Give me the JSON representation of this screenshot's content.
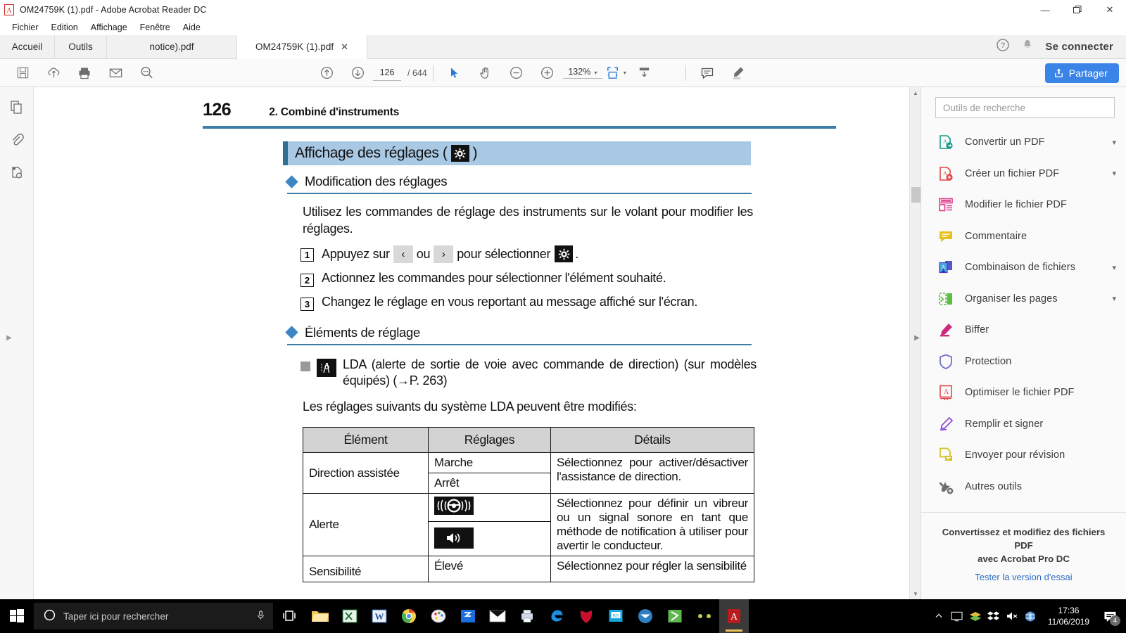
{
  "window": {
    "title": "OM24759K (1).pdf - Adobe Acrobat Reader DC",
    "minimize": "—",
    "restore": "❐",
    "close": "✕"
  },
  "menu": {
    "items": [
      "Fichier",
      "Edition",
      "Affichage",
      "Fenêtre",
      "Aide"
    ]
  },
  "tabs": {
    "home": "Accueil",
    "tools": "Outils",
    "items": [
      {
        "label": "notice).pdf",
        "active": false,
        "closable": false
      },
      {
        "label": "OM24759K (1).pdf",
        "active": true,
        "closable": true,
        "close": "✕"
      }
    ],
    "signin": "Se connecter"
  },
  "toolbar": {
    "save": "save-icon",
    "upload": "cloud-upload-icon",
    "print": "print-icon",
    "email": "email-icon",
    "find": "find-icon",
    "prev_page": "arrow-up-circle-icon",
    "next_page": "arrow-down-circle-icon",
    "page_current": "126",
    "page_separator": "/",
    "page_total": "644",
    "select_tool": "cursor-icon",
    "hand_tool": "hand-icon",
    "zoom_out": "zoom-out-icon",
    "zoom_in": "zoom-in-icon",
    "zoom_level": "132%",
    "zoom_caret": "▾",
    "fit_page": "fit-page-icon",
    "fit_caret": "▾",
    "scroll_mode": "scroll-mode-icon",
    "comment": "comment-icon",
    "highlight": "highlighter-icon",
    "share_label": "Partager"
  },
  "leftrail": {
    "thumbnails": "page-thumbnails-icon",
    "attachments": "attachments-icon",
    "docinfo": "document-info-icon",
    "expand": "▶"
  },
  "document": {
    "page_number": "126",
    "chapter": "2. Combiné d'instruments",
    "section_title_pre": "Affichage des réglages (",
    "section_title_post": ")",
    "subhead_1": "Modification des réglages",
    "intro": "Utilisez les commandes de réglage des instruments sur le volant pour modifier les réglages.",
    "steps": [
      {
        "num": "1",
        "pre": "Appuyez sur",
        "key_left": "‹",
        "mid": "ou",
        "key_right": "›",
        "post": "pour sélectionner",
        "tail": "."
      },
      {
        "num": "2",
        "text": "Actionnez les commandes pour sélectionner l'élément souhaité."
      },
      {
        "num": "3",
        "text": "Changez le réglage en vous reportant au message affiché sur l'écran."
      }
    ],
    "subhead_2": "Éléments de réglage",
    "lda_text": "LDA (alerte de sortie de voie avec commande de direction) (sur modèles équipés) (→P. 263)",
    "lda_intro": "Les réglages suivants du système LDA peuvent être modifiés:",
    "table": {
      "headers": [
        "Élément",
        "Réglages",
        "Détails"
      ],
      "rows": [
        {
          "element": "Direction assistée",
          "settings": [
            "Marche",
            "Arrêt"
          ],
          "details": "Sélectionnez pour activer/désactiver l'assistance de direction."
        },
        {
          "element": "Alerte",
          "settings_icons": [
            "steering-wheel-vibration-icon",
            "speaker-sound-icon"
          ],
          "details": "Sélectionnez pour définir un vibreur ou un signal sonore en tant que méthode de notification à utiliser pour avertir le conducteur."
        },
        {
          "element": "Sensibilité",
          "settings": [
            "Élevé"
          ],
          "details": "Sélectionnez pour régler la sensibilité"
        }
      ]
    }
  },
  "rightpanel": {
    "search_placeholder": "Outils de recherche",
    "tools": [
      {
        "label": "Convertir un PDF",
        "icon": "convert-pdf-icon",
        "chevron": "⌄",
        "expandable": true
      },
      {
        "label": "Créer un fichier PDF",
        "icon": "create-pdf-icon",
        "chevron": "⌄",
        "expandable": true
      },
      {
        "label": "Modifier le fichier PDF",
        "icon": "edit-pdf-icon",
        "expandable": false
      },
      {
        "label": "Commentaire",
        "icon": "comment-icon",
        "expandable": false
      },
      {
        "label": "Combinaison de fichiers",
        "icon": "combine-files-icon",
        "chevron": "⌄",
        "expandable": true
      },
      {
        "label": "Organiser les pages",
        "icon": "organize-pages-icon",
        "chevron": "⌄",
        "expandable": true
      },
      {
        "label": "Biffer",
        "icon": "redact-icon",
        "expandable": false
      },
      {
        "label": "Protection",
        "icon": "protect-shield-icon",
        "expandable": false
      },
      {
        "label": "Optimiser le fichier PDF",
        "icon": "optimize-pdf-icon",
        "expandable": false
      },
      {
        "label": "Remplir et signer",
        "icon": "fill-and-sign-icon",
        "expandable": false
      },
      {
        "label": "Envoyer pour révision",
        "icon": "send-for-review-icon",
        "expandable": false
      },
      {
        "label": "Autres outils",
        "icon": "more-tools-icon",
        "expandable": false
      }
    ],
    "promo_line1": "Convertissez et modifiez des fichiers PDF",
    "promo_line2": "avec Acrobat Pro DC",
    "promo_link": "Tester la version d'essai"
  },
  "taskbar": {
    "start": "windows-start-icon",
    "search_placeholder": "Taper ici pour rechercher",
    "cortana": "cortana-circle-icon",
    "mic": "microphone-icon",
    "taskview": "task-view-icon",
    "apps": [
      {
        "name": "file-explorer-icon",
        "color": "#f5c75b"
      },
      {
        "name": "excel-icon",
        "color": "#d4f0d0"
      },
      {
        "name": "word-icon",
        "color": "#e6eefb"
      },
      {
        "name": "chrome-icon",
        "color": "#ffffff"
      },
      {
        "name": "paint-icon",
        "color": "#f3f3f3"
      },
      {
        "name": "scanner-icon",
        "color": "#1a6ee0"
      },
      {
        "name": "mail-icon",
        "color": "#ffffff"
      },
      {
        "name": "printer-utility-icon",
        "color": "#dfe6ef"
      },
      {
        "name": "edge-icon",
        "color": "#1b8fe0"
      },
      {
        "name": "mcafee-icon",
        "color": "#c8102e"
      },
      {
        "name": "bluestacks-icon",
        "color": "#1aa7dd"
      },
      {
        "name": "mail-client-icon",
        "color": "#2d7fc1"
      },
      {
        "name": "sync-icon",
        "color": "#5eb84f"
      },
      {
        "name": "tool-icon",
        "color": "#c8c84a"
      },
      {
        "name": "acrobat-icon",
        "color": "#d32f2f",
        "open": true
      }
    ],
    "tray": [
      {
        "name": "monitor-icon",
        "color": "#d8d8d8"
      },
      {
        "name": "stack-icon",
        "color": "#6bbf4a"
      },
      {
        "name": "dropbox-icon",
        "color": "#ffffff"
      },
      {
        "name": "volume-muted-icon",
        "color": "#ffffff"
      },
      {
        "name": "network-icon",
        "color": "#5b9bd5"
      }
    ],
    "time": "17:36",
    "date": "11/06/2019",
    "notification_icon": "notification-icon",
    "notification_count": "4"
  },
  "colors": {
    "accent_blue": "#3a84e8",
    "banner_blue": "#a9c8e4",
    "rule_blue": "#3c7fa6",
    "diamond_blue": "#3c86c4"
  }
}
